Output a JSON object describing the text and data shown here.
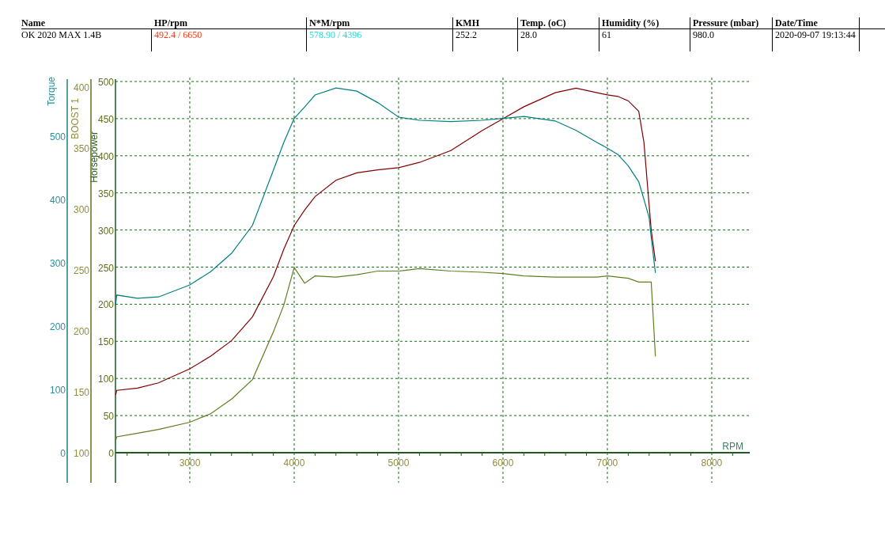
{
  "header_table": {
    "columns": [
      "Name",
      "HP/rpm",
      "N*M/rpm",
      "KMH",
      "Temp. (oC)",
      "Humidity (%)",
      "Pressure (mbar)",
      "Date/Time"
    ],
    "row": [
      {
        "text": "OK 2020 MAX 1.4B"
      },
      {
        "text": "492.4 / 6650",
        "color": "#ff3311"
      },
      {
        "text": "578.90 / 4396",
        "color": "#22dddd"
      },
      {
        "text": "252.2"
      },
      {
        "text": "28.0"
      },
      {
        "text": " 61"
      },
      {
        "text": "980.0"
      },
      {
        "text": "2020-09-07 19:13:44"
      }
    ]
  },
  "charts": [
    {
      "chart_data": {
        "type": "line",
        "xlabel": "RPM",
        "ylabel": "Horsepower",
        "grid": true,
        "xlim": [
          2288,
          8364
        ],
        "ylim": [
          0,
          500
        ],
        "xticks": [
          3000,
          4000,
          5000,
          6000,
          7000,
          8000
        ],
        "yticks": [
          0,
          50,
          100,
          150,
          200,
          250,
          300,
          350,
          400,
          450,
          500
        ],
        "x": [
          2290,
          2300,
          2500,
          2700,
          3000,
          3200,
          3400,
          3600,
          3800,
          3900,
          4000,
          4100,
          4200,
          4400,
          4600,
          4800,
          5000,
          5200,
          5500,
          5800,
          6000,
          6200,
          6500,
          6700,
          6900,
          7000,
          7100,
          7200,
          7300,
          7350,
          7400,
          7420,
          7460
        ],
        "series": [
          {
            "color": "#800000",
            "values": [
              78,
              84,
              87,
              94,
              113,
              130,
              151,
              183,
              237,
              274,
              306,
              327,
              345,
              367,
              377,
              381,
              384,
              391,
              407,
              434,
              450,
              466,
              485,
              491,
              485,
              482,
              480,
              474,
              460,
              418,
              333,
              300,
              258
            ]
          }
        ]
      }
    },
    {
      "chart_data": {
        "type": "line",
        "ylabel": "Torque",
        "xlim": [
          2288,
          8364
        ],
        "ylim": [
          0,
          586.25
        ],
        "yticks": [
          0,
          100,
          200,
          300,
          400,
          500
        ],
        "x": [
          2290,
          2300,
          2500,
          2700,
          3000,
          3200,
          3400,
          3600,
          3800,
          3900,
          4000,
          4100,
          4200,
          4400,
          4600,
          4800,
          5000,
          5200,
          5500,
          5800,
          6000,
          6200,
          6500,
          6700,
          6900,
          7000,
          7100,
          7200,
          7300,
          7350,
          7400,
          7420,
          7460
        ],
        "series": [
          {
            "color": "#008080",
            "values": [
              235,
              249,
              244,
              246,
              265,
              286,
              315,
              359,
              446,
              490,
              528,
              546,
              565,
              576,
              571,
              553,
              530,
              525,
              523,
              525,
              528,
              531,
              524,
              509,
              490,
              481,
              471,
              453,
              428,
              400,
              371,
              340,
              284
            ]
          }
        ]
      }
    },
    {
      "chart_data": {
        "type": "line",
        "ylabel": "BOOST 1",
        "xlim": [
          2288,
          8364
        ],
        "ylim": [
          100,
          404.5
        ],
        "yticks": [
          100,
          150,
          200,
          250,
          300,
          350,
          400
        ],
        "x": [
          2290,
          2300,
          2500,
          2700,
          3000,
          3200,
          3400,
          3600,
          3800,
          3900,
          4000,
          4100,
          4200,
          4400,
          4600,
          4800,
          5000,
          5200,
          5500,
          5800,
          6000,
          6200,
          6500,
          6700,
          6900,
          7000,
          7100,
          7200,
          7300,
          7350,
          7400,
          7420,
          7460
        ],
        "series": [
          {
            "color": "#5f7f1f",
            "values": [
              110,
              113,
              116,
              119,
              125,
              132,
              144,
              160,
              199,
              221,
              252,
              239,
              245,
              244,
              246,
              249,
              249,
              251,
              249,
              248,
              247,
              245,
              244,
              244,
              244,
              245,
              244,
              243,
              240,
              240,
              240,
              240,
              179
            ]
          }
        ]
      }
    }
  ]
}
